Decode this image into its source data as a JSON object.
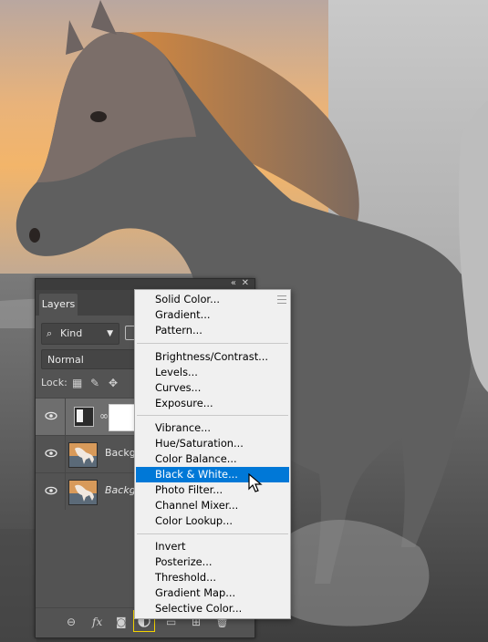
{
  "panel": {
    "collapse_icon": "double-chevron-icon",
    "close_icon": "close-icon",
    "tab_label": "Layers",
    "filter_kind": "Kind",
    "blend_mode": "Normal",
    "lock_label": "Lock:",
    "layers": [
      {
        "name": "",
        "type": "adjustment-with-mask",
        "visible": true,
        "selected": true
      },
      {
        "name": "Backgro",
        "type": "image",
        "visible": true,
        "selected": false,
        "italic": false
      },
      {
        "name": "Backgro",
        "type": "image",
        "visible": true,
        "selected": false,
        "italic": true
      }
    ],
    "bottom_icons": [
      "link-icon",
      "fx-icon",
      "mask-icon",
      "adjustment-icon",
      "group-icon",
      "new-layer-icon",
      "trash-icon"
    ],
    "fx_label": "fx"
  },
  "menu": {
    "groups": [
      [
        "Solid Color...",
        "Gradient...",
        "Pattern..."
      ],
      [
        "Brightness/Contrast...",
        "Levels...",
        "Curves...",
        "Exposure..."
      ],
      [
        "Vibrance...",
        "Hue/Saturation...",
        "Color Balance...",
        "Black & White...",
        "Photo Filter...",
        "Channel Mixer...",
        "Color Lookup..."
      ],
      [
        "Invert",
        "Posterize...",
        "Threshold...",
        "Gradient Map...",
        "Selective Color..."
      ]
    ],
    "highlighted": "Black & White..."
  },
  "colors": {
    "highlight": "#0078d7",
    "adjustment_button_border": "#f4d300",
    "panel_bg": "#535353"
  }
}
